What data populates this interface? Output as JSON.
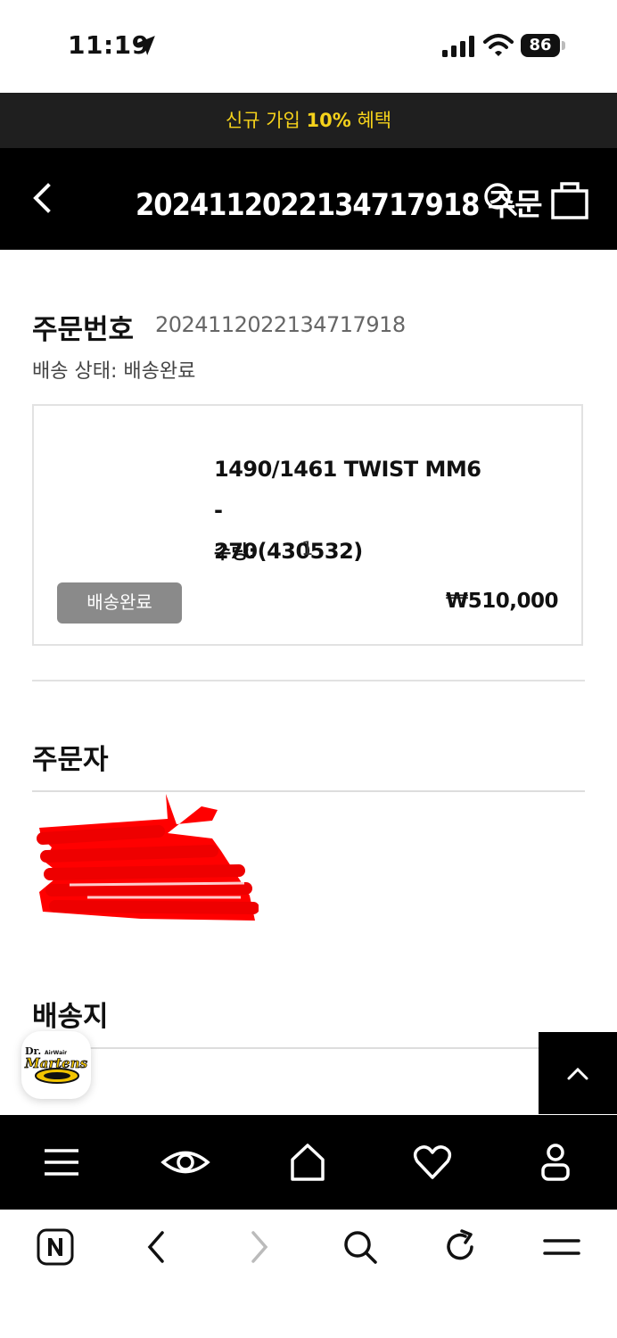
{
  "status_bar": {
    "time": "11:19",
    "battery": "86"
  },
  "promo": {
    "prefix": "신규 가입 ",
    "highlight": "10%",
    "suffix": " 혜택"
  },
  "header": {
    "title": "20241120221347179​18 주문"
  },
  "order": {
    "label": "주문번호",
    "number": "20241120221347179​18",
    "ship_status": "배송 상태: 배송완료"
  },
  "item": {
    "name_line1": "1490/1461 TWIST MM6 -",
    "name_line2": "270(430532)",
    "qty_label": "수량:",
    "qty_value": "1",
    "status_badge": "배송완료",
    "price": "₩510,000"
  },
  "sections": {
    "orderer": "주문자",
    "shipping": "배송지"
  },
  "brand": {
    "logo_text_top": "Dr.",
    "logo_text_air": "AirWair",
    "logo_text_main": "Martens"
  },
  "icons": {
    "header": [
      "back-icon",
      "search-icon",
      "cart-icon"
    ],
    "bottom_nav": [
      "menu-icon",
      "eye-icon",
      "home-icon",
      "heart-icon",
      "user-icon"
    ],
    "browser": [
      "naver-icon",
      "back-icon",
      "forward-icon",
      "search-icon",
      "refresh-icon",
      "menu-icon"
    ]
  },
  "colors": {
    "promo_text": "#f5d21b",
    "redaction": "#ff0000",
    "badge_bg": "#8a8a8a"
  }
}
